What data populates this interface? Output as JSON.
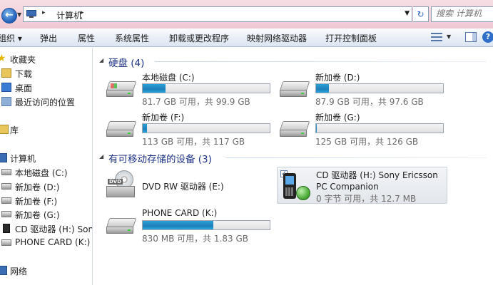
{
  "address": {
    "current_location": "计算机",
    "search_placeholder": "搜索 计算机"
  },
  "toolbar": {
    "organize": "组织 ▾",
    "eject": "弹出",
    "properties": "属性",
    "system_properties": "系统属性",
    "uninstall": "卸载或更改程序",
    "map_drive": "映射网络驱动器",
    "control_panel": "打开控制面板",
    "help": "?"
  },
  "nav": {
    "favorites": "收藏夹",
    "downloads": "下载",
    "desktop": "桌面",
    "recent": "最近访问的位置",
    "libraries": "库",
    "computer": "计算机",
    "local_c": "本地磁盘 (C:)",
    "vol_d": "新加卷 (D:)",
    "vol_f": "新加卷 (F:)",
    "vol_g": "新加卷 (G:)",
    "cd_h": "CD 驱动器 (H:) Sony",
    "phone_k": "PHONE CARD (K:)",
    "network": "网络"
  },
  "groups": {
    "hard_disks": {
      "title": "硬盘 (4)"
    },
    "removable": {
      "title": "有可移动存储的设备 (3)"
    }
  },
  "drives": {
    "c": {
      "name": "本地磁盘 (C:)",
      "free_text": "81.7 GB 可用，共 99.9 GB",
      "used_fraction": 0.182
    },
    "d": {
      "name": "新加卷 (D:)",
      "free_text": "87.9 GB 可用，共 97.6 GB",
      "used_fraction": 0.099
    },
    "f": {
      "name": "新加卷 (F:)",
      "free_text": "113 GB 可用，共 117 GB",
      "used_fraction": 0.034
    },
    "g": {
      "name": "新加卷 (G:)",
      "free_text": "125 GB 可用，共 126 GB",
      "used_fraction": 0.008
    },
    "e": {
      "name": "DVD RW 驱动器 (E:)"
    },
    "h": {
      "name": "CD 驱动器 (H:) Sony Ericsson PC Companion",
      "free_text": "0 字节 可用，共 12.7 MB"
    },
    "k": {
      "name": "PHONE CARD (K:)",
      "free_text": "830 MB 可用，共 1.83 GB",
      "used_fraction": 0.557
    }
  },
  "icons": {
    "dvd_tag": "DVD"
  },
  "colors": {
    "group_title": "#1e3287",
    "usage_bar": "#1f7fb8",
    "topbar": "#f3d3dc"
  }
}
